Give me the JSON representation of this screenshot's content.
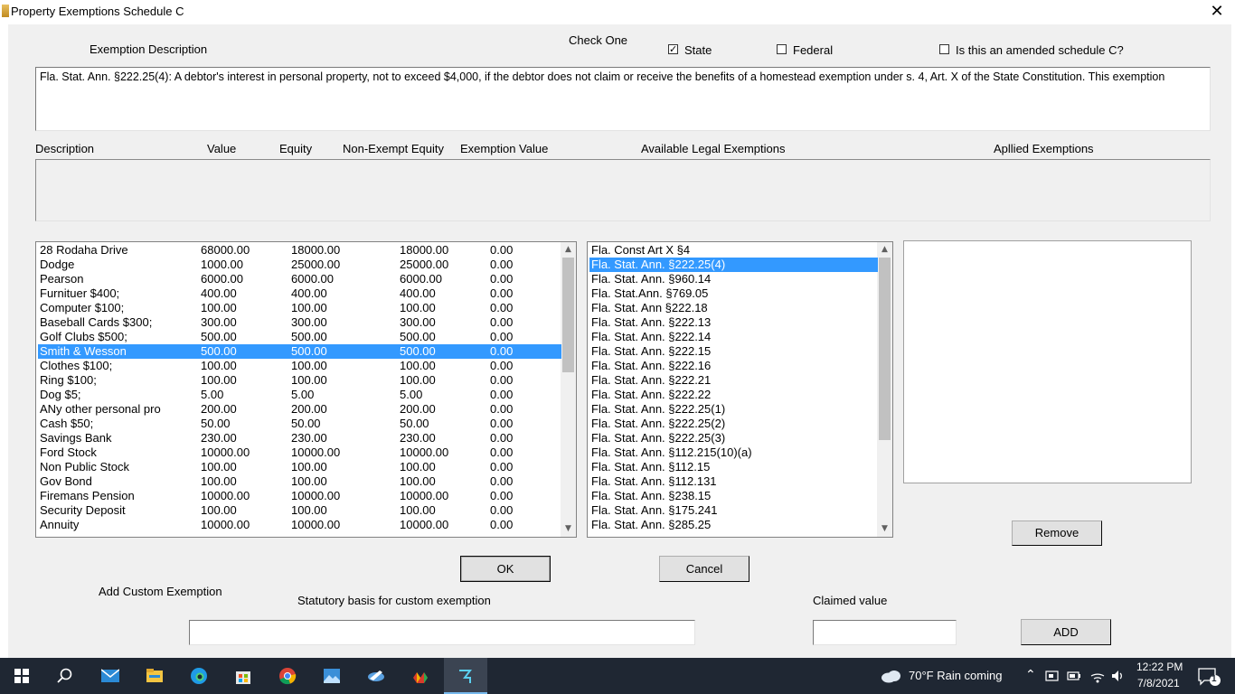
{
  "window": {
    "title": "Property Exemptions Schedule C",
    "close_glyph": "✕"
  },
  "header": {
    "exemption_description_label": "Exemption Description",
    "check_one_label": "Check One",
    "state_label": "State",
    "state_checked": true,
    "federal_label": "Federal",
    "federal_checked": false,
    "amended_label": "Is this an amended schedule C?",
    "amended_checked": false
  },
  "description_text": "Fla. Stat. Ann. §222.25(4): A debtor's interest in personal property, not to exceed $4,000, if the debtor does not claim or receive the benefits of a homestead exemption under s. 4, Art. X of the State Constitution. This exemption",
  "columns": {
    "description": "Description",
    "value": "Value",
    "equity": "Equity",
    "non_exempt_equity": "Non-Exempt Equity",
    "exemption_value": "Exemption Value",
    "available_legal_exemptions": "Available Legal Exemptions",
    "applied_exemptions": "Apllied Exemptions"
  },
  "properties": [
    {
      "description": "28 Rodaha Drive",
      "value": "68000.00",
      "equity": "18000.00",
      "non_exempt": "18000.00",
      "exemption": "0.00"
    },
    {
      "description": "Dodge",
      "value": "1000.00",
      "equity": "25000.00",
      "non_exempt": "25000.00",
      "exemption": "0.00"
    },
    {
      "description": "Pearson",
      "value": "6000.00",
      "equity": "6000.00",
      "non_exempt": "6000.00",
      "exemption": "0.00"
    },
    {
      "description": "Furnituer $400;",
      "value": "400.00",
      "equity": "400.00",
      "non_exempt": "400.00",
      "exemption": "0.00"
    },
    {
      "description": "Computer $100;",
      "value": "100.00",
      "equity": "100.00",
      "non_exempt": "100.00",
      "exemption": "0.00"
    },
    {
      "description": "Baseball Cards $300;",
      "value": "300.00",
      "equity": "300.00",
      "non_exempt": "300.00",
      "exemption": "0.00"
    },
    {
      "description": "Golf Clubs $500;",
      "value": "500.00",
      "equity": "500.00",
      "non_exempt": "500.00",
      "exemption": "0.00"
    },
    {
      "description": "Smith & Wesson",
      "value": "500.00",
      "equity": "500.00",
      "non_exempt": "500.00",
      "exemption": "0.00",
      "selected": true
    },
    {
      "description": "Clothes $100;",
      "value": "100.00",
      "equity": "100.00",
      "non_exempt": "100.00",
      "exemption": "0.00"
    },
    {
      "description": "Ring $100;",
      "value": "100.00",
      "equity": "100.00",
      "non_exempt": "100.00",
      "exemption": "0.00"
    },
    {
      "description": "Dog $5;",
      "value": "5.00",
      "equity": "5.00",
      "non_exempt": "5.00",
      "exemption": "0.00"
    },
    {
      "description": "ANy other personal pro",
      "value": "200.00",
      "equity": "200.00",
      "non_exempt": "200.00",
      "exemption": "0.00"
    },
    {
      "description": "Cash $50;",
      "value": "50.00",
      "equity": "50.00",
      "non_exempt": "50.00",
      "exemption": "0.00"
    },
    {
      "description": "Savings Bank",
      "value": "230.00",
      "equity": "230.00",
      "non_exempt": "230.00",
      "exemption": "0.00"
    },
    {
      "description": "Ford Stock",
      "value": "10000.00",
      "equity": "10000.00",
      "non_exempt": "10000.00",
      "exemption": "0.00"
    },
    {
      "description": "Non Public Stock",
      "value": "100.00",
      "equity": "100.00",
      "non_exempt": "100.00",
      "exemption": "0.00"
    },
    {
      "description": "Gov Bond",
      "value": "100.00",
      "equity": "100.00",
      "non_exempt": "100.00",
      "exemption": "0.00"
    },
    {
      "description": "Firemans Pension",
      "value": "10000.00",
      "equity": "10000.00",
      "non_exempt": "10000.00",
      "exemption": "0.00"
    },
    {
      "description": "Security Deposit",
      "value": "100.00",
      "equity": "100.00",
      "non_exempt": "100.00",
      "exemption": "0.00"
    },
    {
      "description": "Annuity",
      "value": "10000.00",
      "equity": "10000.00",
      "non_exempt": "10000.00",
      "exemption": "0.00"
    }
  ],
  "available_exemptions": [
    {
      "label": "Fla. Const Art X §4"
    },
    {
      "label": "Fla. Stat. Ann. §222.25(4)",
      "selected": true
    },
    {
      "label": "Fla. Stat. Ann. §960.14"
    },
    {
      "label": "Fla. Stat.Ann. §769.05"
    },
    {
      "label": "Fla. Stat. Ann §222.18"
    },
    {
      "label": "Fla. Stat. Ann. §222.13"
    },
    {
      "label": "Fla. Stat. Ann. §222.14"
    },
    {
      "label": "Fla. Stat. Ann. §222.15"
    },
    {
      "label": "Fla. Stat. Ann. §222.16"
    },
    {
      "label": "Fla. Stat. Ann. §222.21"
    },
    {
      "label": "Fla. Stat. Ann. §222.22"
    },
    {
      "label": "Fla. Stat. Ann. §222.25(1)"
    },
    {
      "label": "Fla. Stat. Ann. §222.25(2)"
    },
    {
      "label": "Fla. Stat. Ann. §222.25(3)"
    },
    {
      "label": "Fla. Stat. Ann. §112.215(10)(a)"
    },
    {
      "label": "Fla. Stat. Ann. §112.15"
    },
    {
      "label": "Fla. Stat. Ann. §112.131"
    },
    {
      "label": "Fla. Stat. Ann. §238.15"
    },
    {
      "label": "Fla. Stat. Ann. §175.241"
    },
    {
      "label": "Fla. Stat. Ann. §285.25"
    }
  ],
  "buttons": {
    "remove": "Remove",
    "ok": "OK",
    "cancel": "Cancel",
    "add": "ADD"
  },
  "custom": {
    "add_custom_label": "Add Custom Exemption",
    "statutory_basis_label": "Statutory basis for custom exemption",
    "statutory_basis_value": "",
    "claimed_value_label": "Claimed value",
    "claimed_value_value": ""
  },
  "taskbar": {
    "apps": [
      "start-icon",
      "search-icon",
      "mail-icon",
      "file-explorer-icon",
      "edge-icon",
      "store-icon",
      "chrome-icon",
      "photos-icon",
      "app-icon",
      "app-icon",
      "active-app-icon"
    ],
    "weather": "70°F  Rain coming",
    "time": "12:22 PM",
    "date": "7/8/2021",
    "notification_count": "1",
    "accent": "#76b9ed"
  },
  "colors": {
    "selection": "#3399ff",
    "window_bg": "#f0f0f0",
    "taskbar_bg": "#1f2733"
  }
}
